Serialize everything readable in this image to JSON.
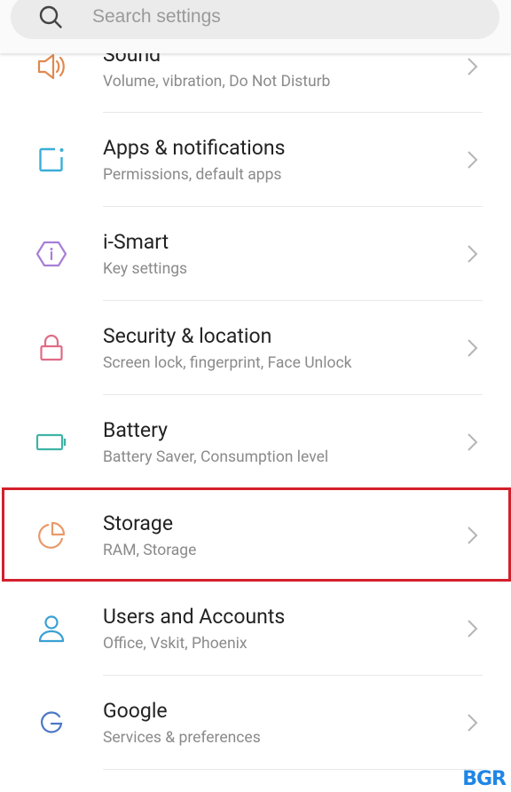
{
  "search": {
    "placeholder": "Search settings",
    "icon": "search-icon"
  },
  "settings": [
    {
      "title": "Sound",
      "subtitle": "Volume, vibration, Do Not Disturb",
      "icon": "speaker-icon",
      "color": "#e0894f"
    },
    {
      "title": "Apps & notifications",
      "subtitle": "Permissions, default apps",
      "icon": "apps-notification-icon",
      "color": "#3aaed8"
    },
    {
      "title": "i-Smart",
      "subtitle": "Key settings",
      "icon": "info-hexagon-icon",
      "color": "#a77fd6"
    },
    {
      "title": "Security & location",
      "subtitle": "Screen lock, fingerprint, Face Unlock",
      "icon": "lock-icon",
      "color": "#e06b86"
    },
    {
      "title": "Battery",
      "subtitle": "Battery Saver, Consumption level",
      "icon": "battery-icon",
      "color": "#3fb3a6"
    },
    {
      "title": "Storage",
      "subtitle": "RAM, Storage",
      "icon": "pie-chart-icon",
      "color": "#e8996a",
      "highlighted": true
    },
    {
      "title": "Users and Accounts",
      "subtitle": "Office, Vskit, Phoenix",
      "icon": "user-icon",
      "color": "#3aa0d4"
    },
    {
      "title": "Google",
      "subtitle": "Services & preferences",
      "icon": "google-icon",
      "color": "#4a77c6"
    }
  ],
  "highlight_color": "#d3202c",
  "watermark": {
    "text": "BGR",
    "color": "#1f86e5"
  }
}
